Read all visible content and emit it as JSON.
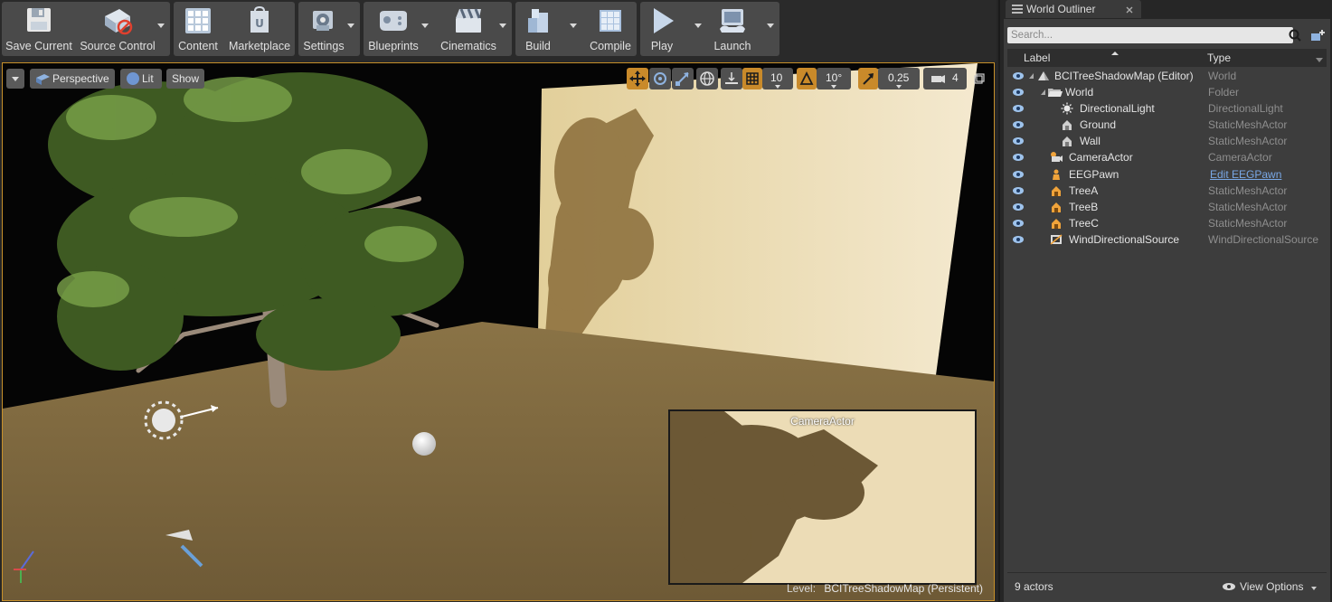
{
  "toolbar": {
    "buttons": [
      {
        "label": "Save Current",
        "icon": "save-icon"
      },
      {
        "label": "Source Control",
        "icon": "source-control-icon"
      },
      {
        "label": "Content",
        "icon": "content-icon"
      },
      {
        "label": "Marketplace",
        "icon": "marketplace-icon"
      },
      {
        "label": "Settings",
        "icon": "settings-icon"
      },
      {
        "label": "Blueprints",
        "icon": "blueprints-icon"
      },
      {
        "label": "Cinematics",
        "icon": "cinematics-icon"
      },
      {
        "label": "Build",
        "icon": "build-icon"
      },
      {
        "label": "Compile",
        "icon": "compile-icon"
      },
      {
        "label": "Play",
        "icon": "play-icon"
      },
      {
        "label": "Launch",
        "icon": "launch-icon"
      }
    ]
  },
  "viewport": {
    "view_mode": "Perspective",
    "lighting": "Lit",
    "show": "Show",
    "grid_snap": "10",
    "rotation_snap": "10°",
    "scale_snap": "0.25",
    "camera_speed": "4",
    "camera_preview_title": "CameraActor",
    "level_prefix": "Level:",
    "level_name": "BCITreeShadowMap (Persistent)"
  },
  "outliner": {
    "tab_title": "World Outliner",
    "search_placeholder": "Search...",
    "col_label": "Label",
    "col_type": "Type",
    "rows": [
      {
        "label": "BCITreeShadowMap (Editor)",
        "type": "World"
      },
      {
        "label": "World",
        "type": "Folder"
      },
      {
        "label": "DirectionalLight",
        "type": "DirectionalLight"
      },
      {
        "label": "Ground",
        "type": "StaticMeshActor"
      },
      {
        "label": "Wall",
        "type": "StaticMeshActor"
      },
      {
        "label": "CameraActor",
        "type": "CameraActor"
      },
      {
        "label": "EEGPawn",
        "type": "Edit EEGPawn"
      },
      {
        "label": "TreeA",
        "type": "StaticMeshActor"
      },
      {
        "label": "TreeB",
        "type": "StaticMeshActor"
      },
      {
        "label": "TreeC",
        "type": "StaticMeshActor"
      },
      {
        "label": "WindDirectionalSource",
        "type": "WindDirectionalSource"
      }
    ],
    "actor_count": "9 actors",
    "view_options": "View Options"
  },
  "colors": {
    "accent": "#c7902a",
    "link": "#79a8e6",
    "panel": "#3d3d3d"
  }
}
